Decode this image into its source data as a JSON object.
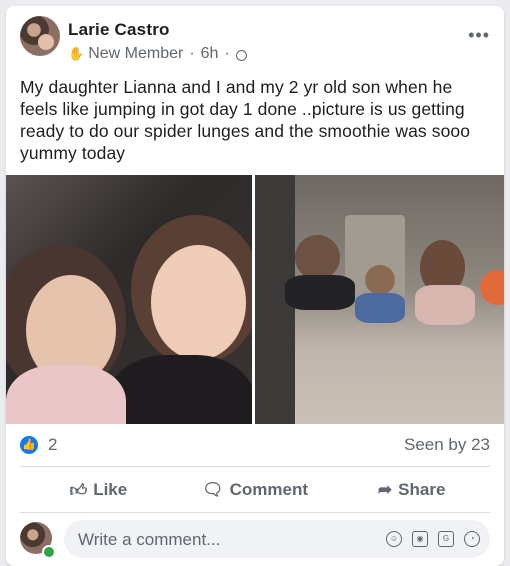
{
  "post": {
    "author": "Larie Castro",
    "badge": "New Member",
    "time": "6h",
    "text": "My daughter Lianna and I and my 2 yr old son when he feels like jumping in got day 1 done ..picture is us getting ready to do our spider lunges and the smoothie was sooo yummy today",
    "more_icon": "more-options-icon"
  },
  "reactions": {
    "count": "2",
    "seen": "Seen by 23"
  },
  "actions": {
    "like": "Like",
    "comment": "Comment",
    "share": "Share"
  },
  "comment": {
    "placeholder": "Write a comment..."
  },
  "colors": {
    "like_blue": "#1877f2",
    "text_grey": "#606770",
    "online_green": "#31a24c"
  }
}
